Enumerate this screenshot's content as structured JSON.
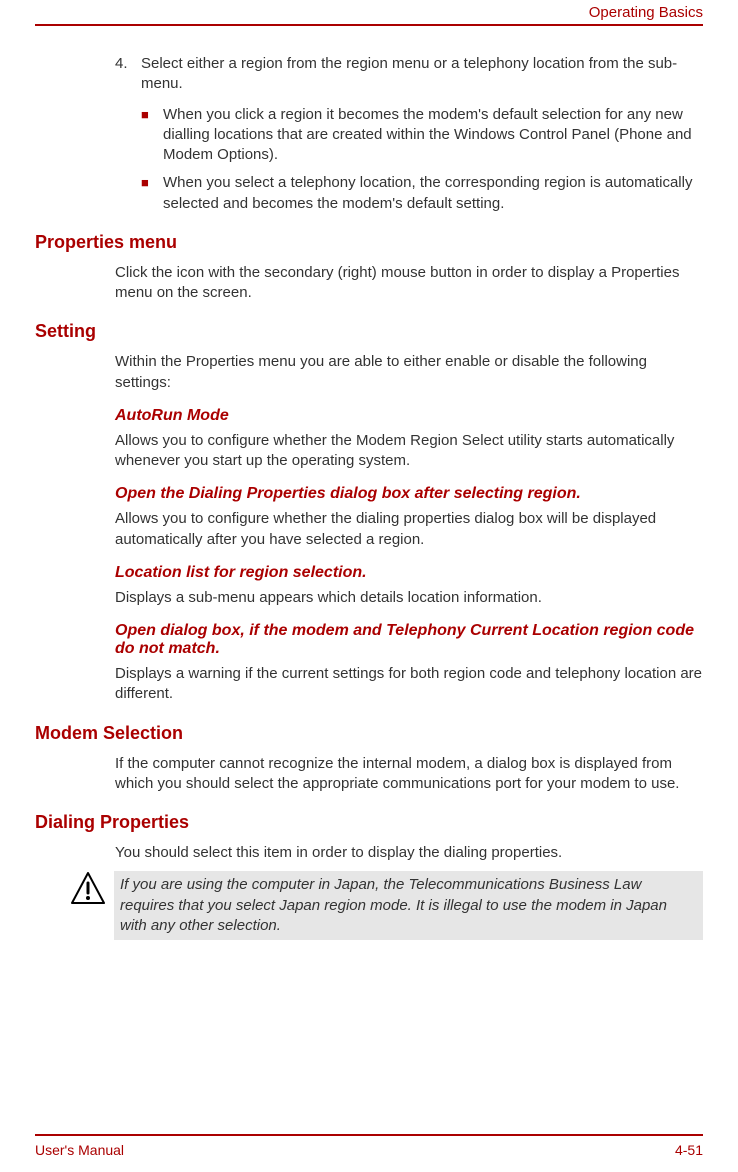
{
  "header": {
    "title": "Operating Basics"
  },
  "step4": {
    "num": "4.",
    "text": "Select either a region from the region menu or a telephony location from the sub-menu."
  },
  "bullets": [
    "When you click a region it becomes the modem's default selection for any new dialling locations that are created within the Windows Control Panel (Phone and Modem Options).",
    "When you select a telephony location, the corresponding region is automatically selected and becomes the modem's default setting."
  ],
  "sections": {
    "properties_menu": {
      "heading": "Properties menu",
      "body": "Click the icon with the secondary (right) mouse button in order to display a Properties menu on the screen."
    },
    "setting": {
      "heading": "Setting",
      "body": "Within the Properties menu you are able to either enable or disable the following settings:",
      "subs": {
        "autorun": {
          "heading": "AutoRun Mode",
          "body": "Allows you to configure whether the Modem Region Select utility starts automatically whenever you start up the operating system."
        },
        "open_dialing": {
          "heading": "Open the Dialing Properties dialog box after selecting region.",
          "body": "Allows you to configure whether the dialing properties dialog box will be displayed automatically after you have selected a region."
        },
        "location_list": {
          "heading": "Location list for region selection.",
          "body": "Displays a sub-menu appears which details location information."
        },
        "open_dialog": {
          "heading": "Open dialog box, if the modem and Telephony Current Location region code do not match.",
          "body": "Displays a warning if the current settings for both region code and telephony location are different."
        }
      }
    },
    "modem_selection": {
      "heading": "Modem Selection",
      "body": "If the computer cannot recognize the internal modem, a dialog box is displayed from which you should select the appropriate communications port for your modem to use."
    },
    "dialing_properties": {
      "heading": "Dialing Properties",
      "body": "You should select this item in order to display the dialing properties.",
      "note": "If you are using the computer in Japan, the Telecommunications Business Law requires that you select Japan region mode. It is illegal to use the modem in Japan with any other selection."
    }
  },
  "footer": {
    "left": "User's Manual",
    "right": "4-51"
  }
}
